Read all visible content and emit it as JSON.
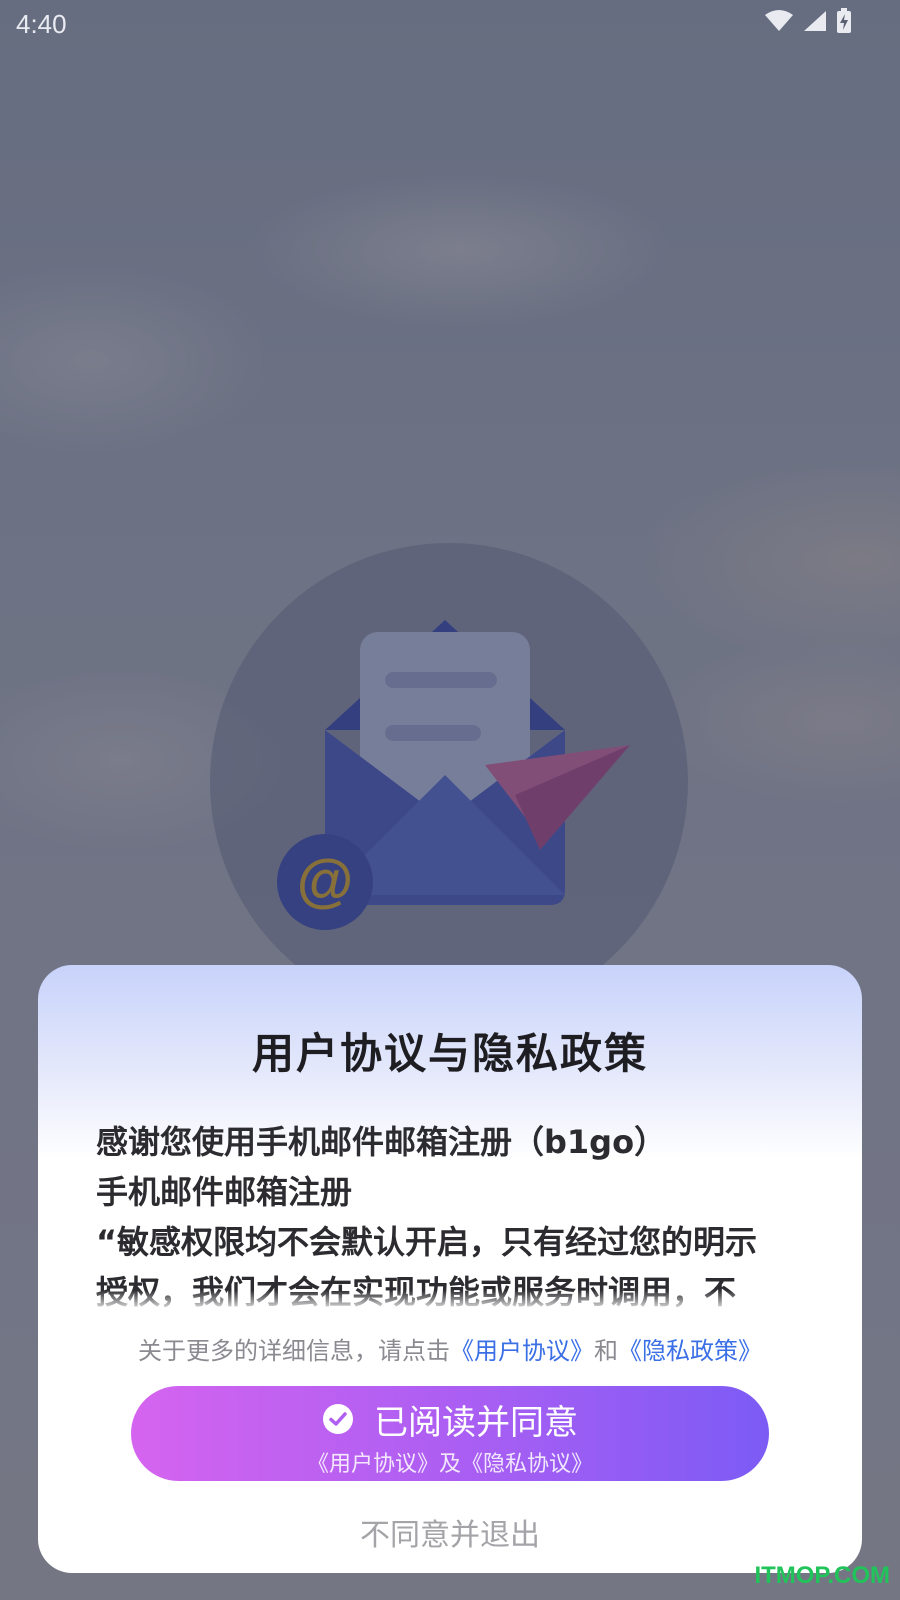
{
  "status_bar": {
    "time": "4:40"
  },
  "dialog": {
    "title": "用户协议与隐私政策",
    "content_lines": [
      "感谢您使用手机邮件邮箱注册（b1go）",
      "手机邮件邮箱注册",
      "“敏感权限均不会默认开启，只有经过您的明示",
      "授权，我们才会在实现功能或服务时调用，不"
    ],
    "more_info": {
      "prefix": "关于更多的详细信息，请点击",
      "user_agreement_link": "《用户协议》",
      "conjunction": "和",
      "privacy_policy_link": "《隐私政策》"
    },
    "agree_button": {
      "label": "已阅读并同意",
      "sub_label": "《用户协议》及《隐私协议》"
    },
    "disagree_label": "不同意并退出"
  },
  "watermark": "ITMOP.COM",
  "colors": {
    "accent_gradient_start": "#d564ef",
    "accent_gradient_end": "#7c5bf5",
    "link": "#3a6fe6"
  },
  "icons": [
    "wifi-icon",
    "signal-icon",
    "battery-charging-icon",
    "check-circle-icon",
    "email-envelope-illustration",
    "paper-plane-illustration",
    "at-sign-badge"
  ]
}
